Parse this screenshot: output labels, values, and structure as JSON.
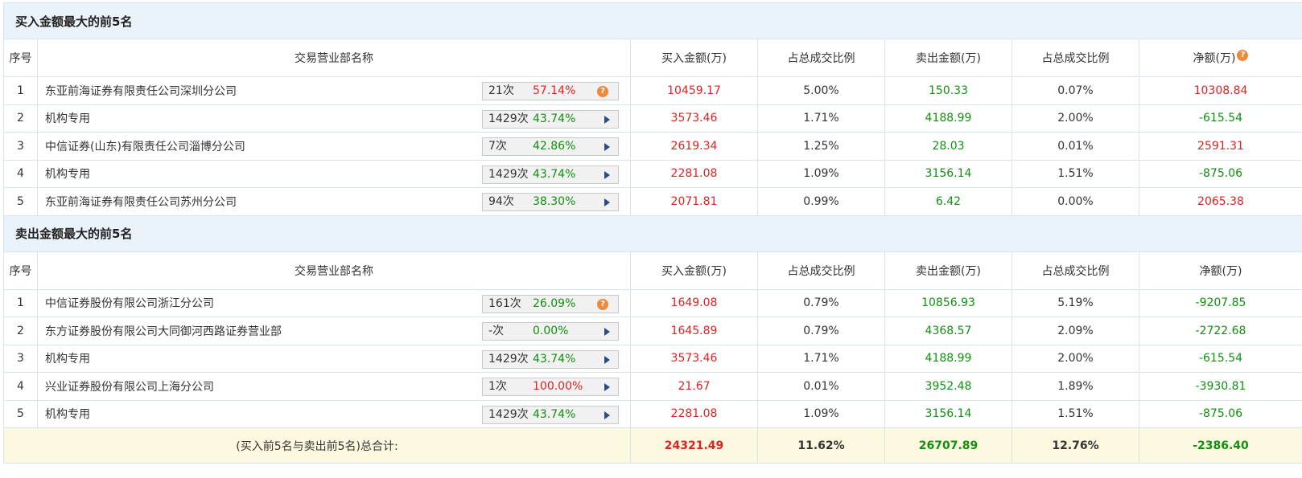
{
  "buy_top5": {
    "title": "买入金额最大的前5名",
    "headers": {
      "idx": "序号",
      "name": "交易营业部名称",
      "buy": "买入金额(万)",
      "buy_ratio": "占总成交比例",
      "sell": "卖出金额(万)",
      "sell_ratio": "占总成交比例",
      "net": "净额(万)"
    },
    "rows": [
      {
        "idx": "1",
        "name": "东亚前海证券有限责任公司深圳分公司",
        "count": "21次",
        "pct": "57.14%",
        "pct_color": "red",
        "icon": "question-icon",
        "buy": "10459.17",
        "buy_ratio": "5.00%",
        "sell": "150.33",
        "sell_ratio": "0.07%",
        "net": "10308.84",
        "net_color": "red"
      },
      {
        "idx": "2",
        "name": "机构专用",
        "count": "1429次",
        "pct": "43.74%",
        "pct_color": "green",
        "icon": "arrow-right-icon",
        "buy": "3573.46",
        "buy_ratio": "1.71%",
        "sell": "4188.99",
        "sell_ratio": "2.00%",
        "net": "-615.54",
        "net_color": "green"
      },
      {
        "idx": "3",
        "name": "中信证券(山东)有限责任公司淄博分公司",
        "count": "7次",
        "pct": "42.86%",
        "pct_color": "green",
        "icon": "arrow-right-icon",
        "buy": "2619.34",
        "buy_ratio": "1.25%",
        "sell": "28.03",
        "sell_ratio": "0.01%",
        "net": "2591.31",
        "net_color": "red"
      },
      {
        "idx": "4",
        "name": "机构专用",
        "count": "1429次",
        "pct": "43.74%",
        "pct_color": "green",
        "icon": "arrow-right-icon",
        "buy": "2281.08",
        "buy_ratio": "1.09%",
        "sell": "3156.14",
        "sell_ratio": "1.51%",
        "net": "-875.06",
        "net_color": "green"
      },
      {
        "idx": "5",
        "name": "东亚前海证券有限责任公司苏州分公司",
        "count": "94次",
        "pct": "38.30%",
        "pct_color": "green",
        "icon": "arrow-right-icon",
        "buy": "2071.81",
        "buy_ratio": "0.99%",
        "sell": "6.42",
        "sell_ratio": "0.00%",
        "net": "2065.38",
        "net_color": "red"
      }
    ]
  },
  "sell_top5": {
    "title": "卖出金额最大的前5名",
    "headers": {
      "idx": "序号",
      "name": "交易营业部名称",
      "buy": "买入金额(万)",
      "buy_ratio": "占总成交比例",
      "sell": "卖出金额(万)",
      "sell_ratio": "占总成交比例",
      "net": "净额(万)"
    },
    "rows": [
      {
        "idx": "1",
        "name": "中信证券股份有限公司浙江分公司",
        "count": "161次",
        "pct": "26.09%",
        "pct_color": "green",
        "icon": "question-icon",
        "buy": "1649.08",
        "buy_ratio": "0.79%",
        "sell": "10856.93",
        "sell_ratio": "5.19%",
        "net": "-9207.85",
        "net_color": "green"
      },
      {
        "idx": "2",
        "name": "东方证券股份有限公司大同御河西路证券营业部",
        "count": "-次",
        "pct": "0.00%",
        "pct_color": "green",
        "icon": "arrow-right-icon",
        "buy": "1645.89",
        "buy_ratio": "0.79%",
        "sell": "4368.57",
        "sell_ratio": "2.09%",
        "net": "-2722.68",
        "net_color": "green"
      },
      {
        "idx": "3",
        "name": "机构专用",
        "count": "1429次",
        "pct": "43.74%",
        "pct_color": "green",
        "icon": "arrow-right-icon",
        "buy": "3573.46",
        "buy_ratio": "1.71%",
        "sell": "4188.99",
        "sell_ratio": "2.00%",
        "net": "-615.54",
        "net_color": "green"
      },
      {
        "idx": "4",
        "name": "兴业证券股份有限公司上海分公司",
        "count": "1次",
        "pct": "100.00%",
        "pct_color": "red",
        "icon": "arrow-right-icon",
        "buy": "21.67",
        "buy_ratio": "0.01%",
        "sell": "3952.48",
        "sell_ratio": "1.89%",
        "net": "-3930.81",
        "net_color": "green"
      },
      {
        "idx": "5",
        "name": "机构专用",
        "count": "1429次",
        "pct": "43.74%",
        "pct_color": "green",
        "icon": "arrow-right-icon",
        "buy": "2281.08",
        "buy_ratio": "1.09%",
        "sell": "3156.14",
        "sell_ratio": "1.51%",
        "net": "-875.06",
        "net_color": "green"
      }
    ]
  },
  "total": {
    "label": "(买入前5名与卖出前5名)总合计:",
    "buy": "24321.49",
    "buy_ratio": "11.62%",
    "sell": "26707.89",
    "sell_ratio": "12.76%",
    "net": "-2386.40"
  },
  "colors": {
    "red": "#e02222",
    "green": "#11900f",
    "header_bg": "#eaf3fa",
    "total_bg": "#fdf8e0"
  }
}
